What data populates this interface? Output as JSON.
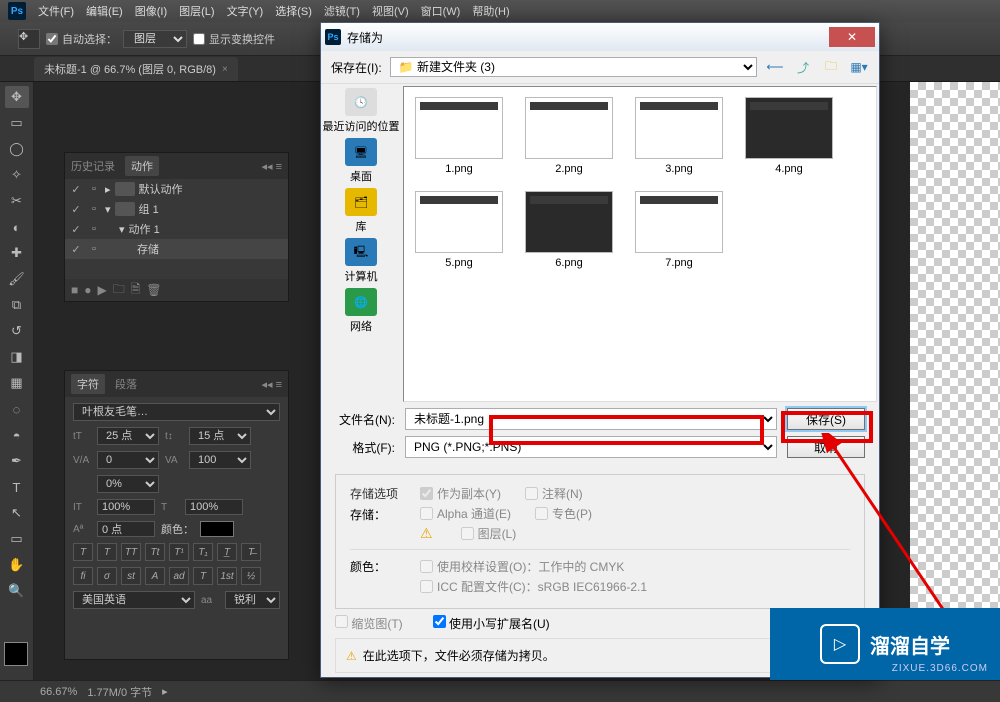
{
  "menubar": {
    "items": [
      "文件(F)",
      "编辑(E)",
      "图像(I)",
      "图层(L)",
      "文字(Y)",
      "选择(S)",
      "滤镜(T)",
      "视图(V)",
      "窗口(W)",
      "帮助(H)"
    ]
  },
  "optionsbar": {
    "autoselect_label": "自动选择：",
    "autoselect_checked": true,
    "target": "图层",
    "transform_label": "显示变换控件"
  },
  "tab": {
    "title": "未标题-1 @ 66.7% (图层 0, RGB/8)",
    "close": "×"
  },
  "history_panel": {
    "tabs": [
      "历史记录",
      "动作"
    ],
    "items": [
      {
        "label": "默认动作",
        "chk": true
      },
      {
        "label": "组 1",
        "chk": true
      },
      {
        "label": "动作 1",
        "chk": true,
        "indent": 1,
        "selected": false,
        "play": true
      },
      {
        "label": "存储",
        "chk": true,
        "indent": 2,
        "selected": true
      }
    ]
  },
  "char_panel": {
    "tabs": [
      "字符",
      "段落"
    ],
    "font": "叶根友毛笔…",
    "size": "25 点",
    "leading": "15 点",
    "va": "0",
    "tracking": "100",
    "height": "100%",
    "width": "100%",
    "baseline": "0 点",
    "color_label": "颜色：",
    "lang": "美国英语",
    "aa": "锐利"
  },
  "statusbar": {
    "zoom": "66.67%",
    "docsize": "1.77M/0 字节"
  },
  "dialog": {
    "title": "存储为",
    "save_in_label": "保存在(I):",
    "folder": "新建文件夹 (3)",
    "places": [
      "最近访问的位置",
      "桌面",
      "库",
      "计算机",
      "网络"
    ],
    "files": [
      "1.png",
      "2.png",
      "3.png",
      "4.png",
      "5.png",
      "6.png",
      "7.png"
    ],
    "filename_label": "文件名(N):",
    "filename_value": "未标题-1.png",
    "format_label": "格式(F):",
    "format_value": "PNG (*.PNG;*.PNS)",
    "save_btn": "保存(S)",
    "cancel_btn": "取消",
    "storage_opts_hdr": "存储选项",
    "storage_label": "存储：",
    "opt_as_copy": "作为副本(Y)",
    "opt_notes": "注释(N)",
    "opt_alpha": "Alpha 通道(E)",
    "opt_spot": "专色(P)",
    "opt_layers": "图层(L)",
    "color_hdr": "颜色：",
    "opt_proof": "使用校样设置(O)：工作中的 CMYK",
    "opt_icc": "ICC 配置文件(C)：sRGB IEC61966-2.1",
    "opt_thumb": "缩览图(T)",
    "opt_lowerext": "使用小写扩展名(U)",
    "alert_text": "在此选项下，文件必须存储为拷贝。"
  },
  "watermark": {
    "brand": "溜溜自学",
    "sub": "ZIXUE.3D66.COM"
  }
}
